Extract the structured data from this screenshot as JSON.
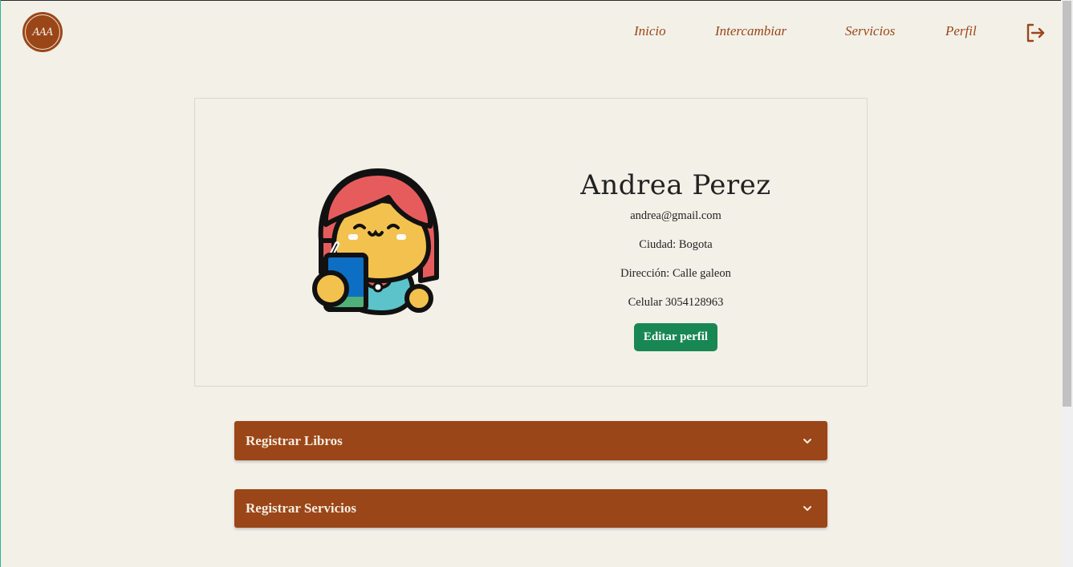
{
  "logo": {
    "text": "AAA"
  },
  "nav": {
    "inicio": "Inicio",
    "intercambiar": "Intercambiar",
    "servicios": "Servicios",
    "perfil": "Perfil"
  },
  "profile": {
    "name": "Andrea Perez",
    "email": "andrea@gmail.com",
    "city": "Ciudad: Bogota",
    "address": "Dirección: Calle galeon",
    "phone": "Celular 3054128963",
    "edit_label": "Editar perfil"
  },
  "accordions": [
    {
      "label": "Registrar Libros"
    },
    {
      "label": "Registrar Servicios"
    }
  ],
  "colors": {
    "background": "#f3f0e8",
    "brand": "#9a4618",
    "button": "#198754"
  }
}
